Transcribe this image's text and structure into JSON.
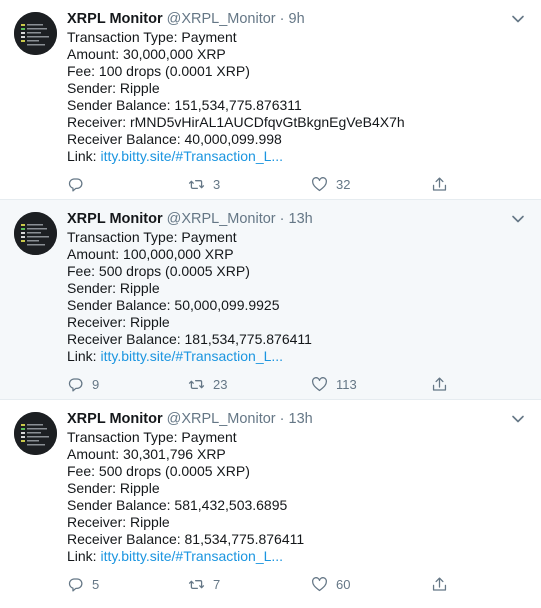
{
  "tweets": [
    {
      "display_name": "XRPL Monitor",
      "handle": "@XRPL_Monitor",
      "time": "9h",
      "lines": [
        "Transaction Type: Payment",
        "Amount: 30,000,000 XRP",
        "Fee: 100 drops (0.0001 XRP)",
        "Sender: Ripple",
        "Sender Balance: 151,534,775.876311",
        "Receiver: rMND5vHirAL1AUCDfqvGtBkgnEgVeB4X7h",
        "Receiver Balance: 40,000,099.998"
      ],
      "link_label": "Link: ",
      "link_text": "itty.bitty.site/#Transaction_L...",
      "replies": "",
      "retweets": "3",
      "likes": "32"
    },
    {
      "display_name": "XRPL Monitor",
      "handle": "@XRPL_Monitor",
      "time": "13h",
      "lines": [
        "Transaction Type: Payment",
        "Amount: 100,000,000 XRP",
        "Fee: 500 drops (0.0005 XRP)",
        "Sender: Ripple",
        "Sender Balance: 50,000,099.9925",
        "Receiver: Ripple",
        "Receiver Balance: 181,534,775.876411"
      ],
      "link_label": "Link: ",
      "link_text": "itty.bitty.site/#Transaction_L...",
      "replies": "9",
      "retweets": "23",
      "likes": "113"
    },
    {
      "display_name": "XRPL Monitor",
      "handle": "@XRPL_Monitor",
      "time": "13h",
      "lines": [
        "Transaction Type: Payment",
        "Amount: 30,301,796 XRP",
        "Fee: 500 drops (0.0005 XRP)",
        "Sender: Ripple",
        "Sender Balance: 581,432,503.6895",
        "Receiver: Ripple",
        "Receiver Balance: 81,534,775.876411"
      ],
      "link_label": "Link: ",
      "link_text": "itty.bitty.site/#Transaction_L...",
      "replies": "5",
      "retweets": "7",
      "likes": "60"
    }
  ],
  "colors": {
    "text": "#14171a",
    "muted": "#657786",
    "link": "#1b95e0",
    "divider": "#e6ecf0",
    "hover_bg": "#f5f8fa"
  },
  "icons": {
    "avatar": "terminal-screenshot-avatar",
    "menu": "chevron-down-icon",
    "reply": "reply-icon",
    "retweet": "retweet-icon",
    "like": "heart-icon",
    "share": "share-icon"
  }
}
